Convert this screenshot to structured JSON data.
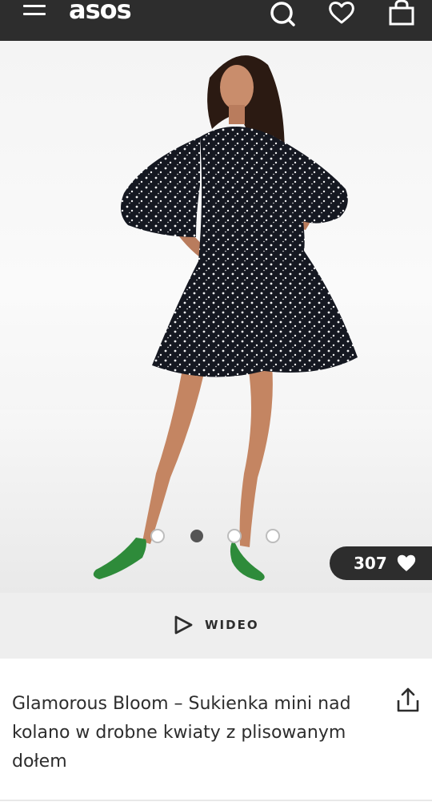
{
  "header": {
    "logo_text": "asos",
    "icons": [
      "menu-icon",
      "search-icon",
      "heart-icon",
      "bag-icon"
    ]
  },
  "product": {
    "title": "Glamorous Bloom – Sukienka mini nad kolano w drobne kwiaty z plisowanym dołem",
    "likes": "307",
    "carousel": {
      "total": 4,
      "active_index": 2
    }
  },
  "video": {
    "label": "WIDEO"
  },
  "colors": {
    "header_bg": "#2d2d2d",
    "video_bar_bg": "#eeeeee",
    "text": "#2d2d2d",
    "shoe_green": "#2e8b3a"
  }
}
